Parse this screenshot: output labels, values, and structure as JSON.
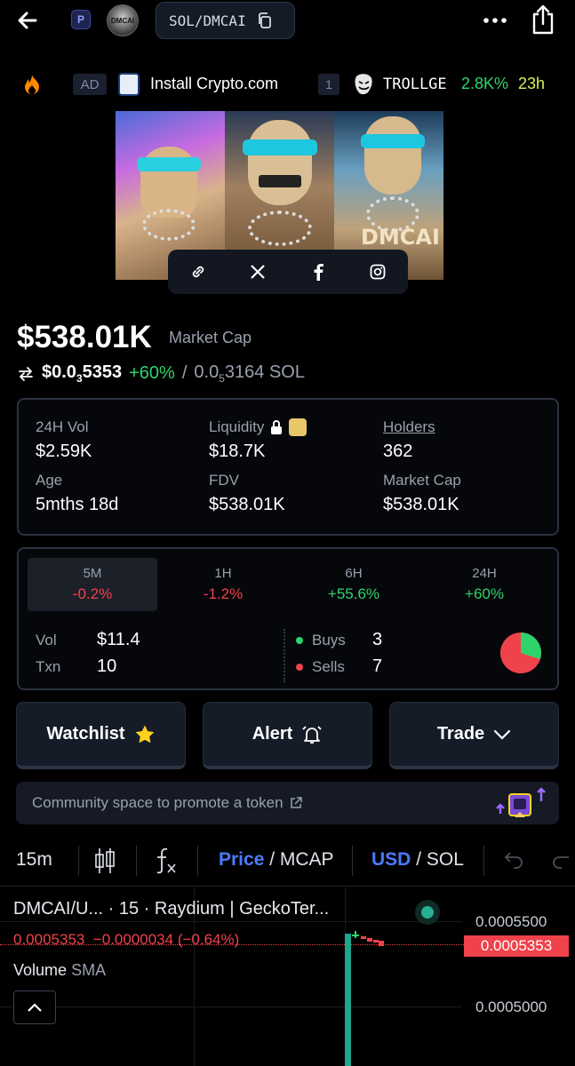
{
  "header": {
    "chain_badge": "P",
    "token_logo_text": "DMCAI",
    "pair": "SOL/DMCAI",
    "icons": [
      "back-arrow-icon",
      "copy-icon",
      "more-dots-icon",
      "share-icon"
    ]
  },
  "ticker": {
    "ad_badge": "AD",
    "ad_text": "Install Crypto.com",
    "rank": "1",
    "trend_name": "TROLLGE",
    "trend_change": "2.8K%",
    "trend_age": "23h"
  },
  "banner": {
    "panel_text": "DMCAI",
    "socials": [
      "link-icon",
      "x-icon",
      "facebook-icon",
      "instagram-icon"
    ]
  },
  "market": {
    "cap_value": "$538.01K",
    "cap_label": "Market Cap",
    "price_usd_prefix": "$0.0",
    "price_usd_sub": "3",
    "price_usd_suffix": "5353",
    "price_change": "+60%",
    "separator": "/",
    "price_sol_prefix": "0.0",
    "price_sol_sub": "5",
    "price_sol_suffix": "3164 SOL"
  },
  "stats": {
    "vol_label": "24H Vol",
    "vol_value": "$2.59K",
    "liq_label": "Liquidity",
    "liq_value": "$18.7K",
    "holders_label": "Holders",
    "holders_value": "362",
    "age_label": "Age",
    "age_value": "5mths 18d",
    "fdv_label": "FDV",
    "fdv_value": "$538.01K",
    "mc_label": "Market Cap",
    "mc_value": "$538.01K"
  },
  "timeframes": [
    {
      "label": "5M",
      "change": "-0.2%"
    },
    {
      "label": "1H",
      "change": "-1.2%"
    },
    {
      "label": "6H",
      "change": "+55.6%"
    },
    {
      "label": "24H",
      "change": "+60%"
    }
  ],
  "activity": {
    "vol_label": "Vol",
    "vol_value": "$11.4",
    "txn_label": "Txn",
    "txn_value": "10",
    "buys_label": "Buys",
    "buys_value": "3",
    "sells_label": "Sells",
    "sells_value": "7",
    "buy_fraction": 0.3
  },
  "actions": {
    "watchlist": "Watchlist",
    "alert": "Alert",
    "trade": "Trade"
  },
  "community": {
    "text": "Community space to promote a token"
  },
  "chart_toolbar": {
    "interval": "15m",
    "price": "Price",
    "mcap": "/ MCAP",
    "usd": "USD",
    "sol": "/ SOL"
  },
  "chart": {
    "title": "DMCAI/U... · 15 · Raydium | GeckoTer...",
    "ohlc": "0.0005353  −0.0000034 (−0.64%)",
    "volume_label": "Volume",
    "volume_sma": "SMA",
    "axis_top": "0.0005500",
    "axis_current": "0.0005353",
    "axis_bottom": "0.0005000"
  },
  "colors": {
    "green": "#2fd36b",
    "red": "#f0424b",
    "blue": "#4a7bff",
    "panel": "#151c28"
  }
}
